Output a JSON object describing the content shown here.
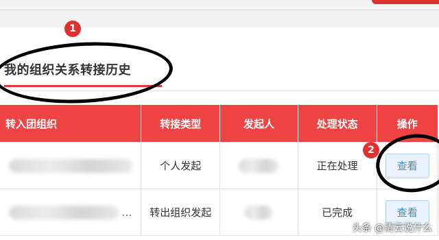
{
  "page": {
    "title": "我的组织关系转接历史",
    "badges": [
      "1",
      "2"
    ]
  },
  "table": {
    "headers": [
      "转入团组织",
      "转接类型",
      "发起人",
      "处理状态",
      "操作"
    ],
    "rows": [
      {
        "org": "",
        "type": "个人发起",
        "initiator": "",
        "status": "正在处理",
        "action": "查看"
      },
      {
        "org": "…",
        "type": "转出组织发起",
        "initiator": "",
        "status": "已完成",
        "action": "查看"
      }
    ]
  },
  "watermark": "头条 @清云说什么",
  "colors": {
    "header_red": "#ef4444",
    "status_active": "#e53935",
    "view_button": "#3b8ddb",
    "annotation_badge": "#e03131"
  }
}
